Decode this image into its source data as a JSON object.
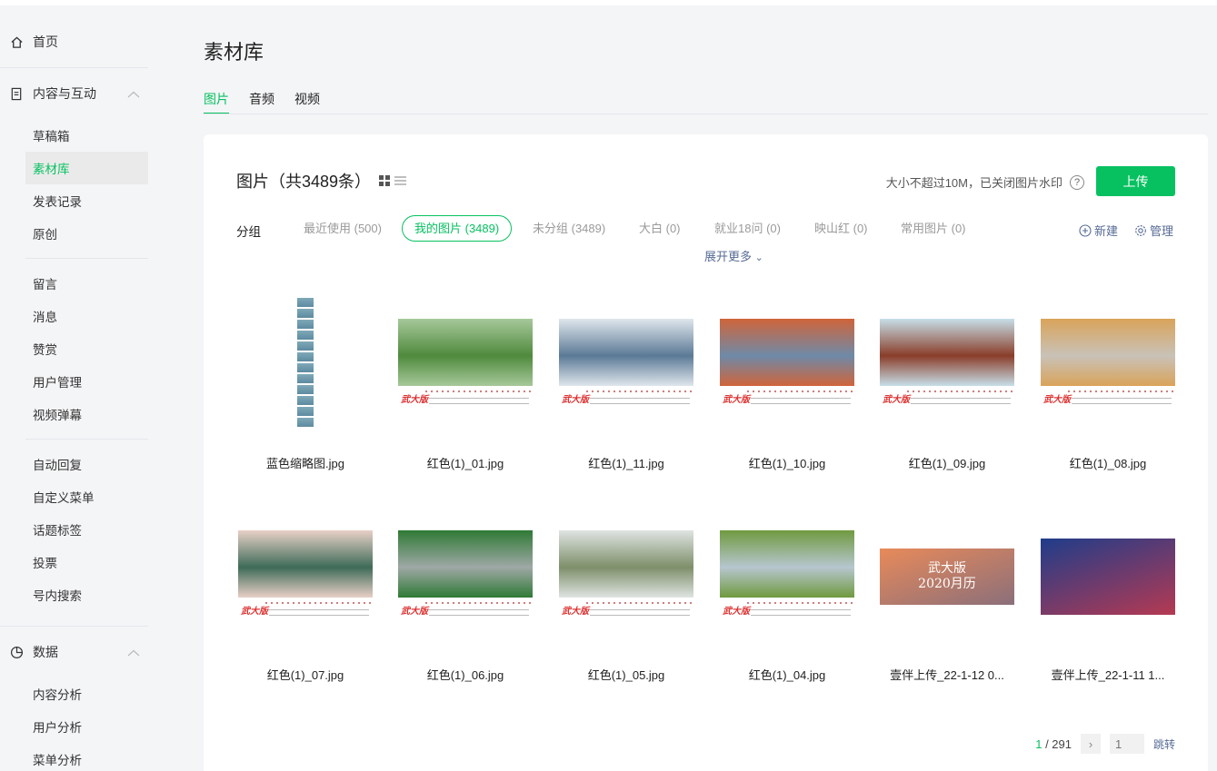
{
  "sidebar": {
    "home": "首页",
    "content_section": "内容与互动",
    "content_items": [
      "草稿箱",
      "素材库",
      "发表记录",
      "原创"
    ],
    "interaction_items": [
      "留言",
      "消息",
      "赞赏",
      "用户管理",
      "视频弹幕"
    ],
    "tool_items": [
      "自动回复",
      "自定义菜单",
      "话题标签",
      "投票",
      "号内搜索"
    ],
    "data_section": "数据",
    "data_items": [
      "内容分析",
      "用户分析",
      "菜单分析"
    ],
    "active_item": "素材库",
    "collapse_icon": "chevron-up-icon"
  },
  "page": {
    "title": "素材库",
    "tabs": [
      "图片",
      "音频",
      "视频"
    ],
    "active_tab": "图片"
  },
  "panel": {
    "heading": "图片（共3489条）",
    "hint": "大小不超过10M，已关闭图片水印",
    "help": "?",
    "upload": "上传",
    "group_label": "分组",
    "groups": [
      "最近使用 (500)",
      "我的图片 (3489)",
      "未分组 (3489)",
      "大白 (0)",
      "就业18问 (0)",
      "映山红 (0)",
      "常用图片 (0)"
    ],
    "active_group": "我的图片 (3489)",
    "new_group": "新建",
    "manage": "管理",
    "expand_more": "展开更多"
  },
  "images": [
    {
      "name": "蓝色缩略图.jpg",
      "kind": "long",
      "colors": [
        "#7fa9b8",
        "#5d8aa0"
      ]
    },
    {
      "name": "红色(1)_01.jpg",
      "kind": "calendar",
      "colors": [
        "#a7c89a",
        "#4f8a3d"
      ]
    },
    {
      "name": "红色(1)_11.jpg",
      "kind": "calendar",
      "colors": [
        "#dfe6ec",
        "#5b7a96"
      ]
    },
    {
      "name": "红色(1)_10.jpg",
      "kind": "calendar",
      "colors": [
        "#d0643a",
        "#6e8aa8"
      ]
    },
    {
      "name": "红色(1)_09.jpg",
      "kind": "calendar",
      "colors": [
        "#c7dfe8",
        "#8a3d2a"
      ]
    },
    {
      "name": "红色(1)_08.jpg",
      "kind": "calendar",
      "colors": [
        "#d9a35a",
        "#c9c2b8"
      ]
    },
    {
      "name": "红色(1)_07.jpg",
      "kind": "calendar",
      "colors": [
        "#e9d0c7",
        "#3e6b58"
      ]
    },
    {
      "name": "红色(1)_06.jpg",
      "kind": "calendar",
      "colors": [
        "#2f7a35",
        "#9fa8a6"
      ]
    },
    {
      "name": "红色(1)_05.jpg",
      "kind": "calendar",
      "colors": [
        "#dfe4e2",
        "#7e8f6a"
      ]
    },
    {
      "name": "红色(1)_04.jpg",
      "kind": "calendar",
      "colors": [
        "#6f9a3f",
        "#b7c6cf"
      ]
    },
    {
      "name": "壹伴上传_22-1-12 0...",
      "kind": "photo",
      "caption": "武大版 2020月历",
      "colors": [
        "#e88a5a",
        "#8b6f7a"
      ]
    },
    {
      "name": "壹伴上传_22-1-11 1...",
      "kind": "photo",
      "caption": "",
      "colors": [
        "#1f3c8a",
        "#b53a52"
      ]
    }
  ],
  "pager": {
    "current": "1",
    "total": "/ 291",
    "next": "›",
    "input_placeholder": "1",
    "jump": "跳转"
  }
}
